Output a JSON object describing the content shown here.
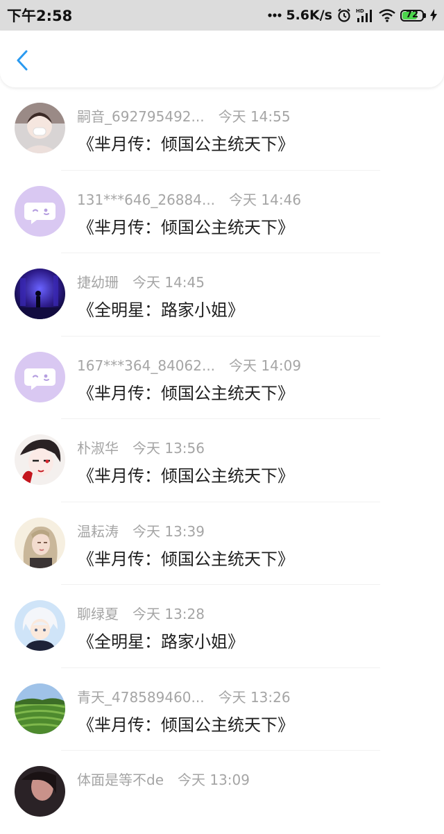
{
  "status_bar": {
    "time": "下午2:58",
    "network_speed": "5.6K/s",
    "battery_level": "72",
    "icons": [
      "dots-icon",
      "alarm-icon",
      "hd-signal-icon",
      "wifi-icon",
      "battery-icon",
      "charging-icon"
    ]
  },
  "header": {
    "back_icon": "chevron-left-icon",
    "accent_color": "#2a9af0"
  },
  "messages": [
    {
      "name": "嗣音_692795492...",
      "time": "今天 14:55",
      "title": "《芈月传：倾国公主统天下》",
      "avatar": "photo-girl-mask"
    },
    {
      "name": "131***646_26884...",
      "time": "今天 14:46",
      "title": "《芈月传：倾国公主统天下》",
      "avatar": "default-chat-bubble"
    },
    {
      "name": "捷幼珊",
      "time": "今天 14:45",
      "title": "《全明星：路家小姐》",
      "avatar": "photo-night-silhouette"
    },
    {
      "name": "167***364_84062...",
      "time": "今天 14:09",
      "title": "《芈月传：倾国公主统天下》",
      "avatar": "default-chat-bubble"
    },
    {
      "name": "朴淑华",
      "time": "今天 13:56",
      "title": "《芈月传：倾国公主统天下》",
      "avatar": "illustration-red-eye"
    },
    {
      "name": "温耘涛",
      "time": "今天 13:39",
      "title": "《芈月传：倾国公主统天下》",
      "avatar": "photo-blonde-girl"
    },
    {
      "name": "聊绿夏",
      "time": "今天 13:28",
      "title": "《全明星：路家小姐》",
      "avatar": "anime-white-hair"
    },
    {
      "name": "青天_478589460...",
      "time": "今天 13:26",
      "title": "《芈月传：倾国公主统天下》",
      "avatar": "photo-tea-field"
    },
    {
      "name": "体面是等不de",
      "time": "今天 13:09",
      "title": "",
      "avatar": "photo-dark-portrait"
    }
  ]
}
